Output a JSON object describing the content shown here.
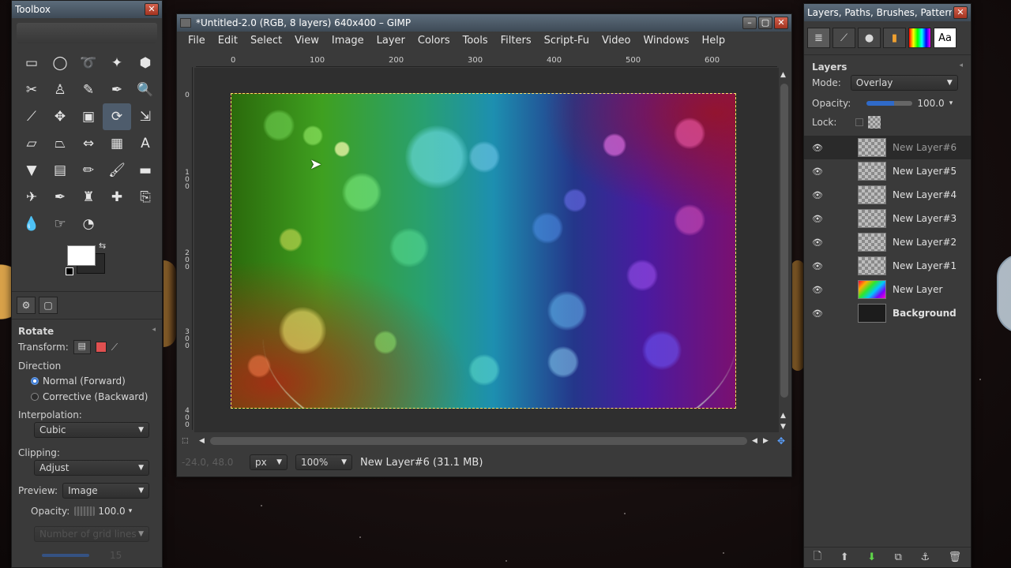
{
  "toolbox": {
    "title": "Toolbox",
    "tools": [
      "rect-select-icon",
      "ellipse-select-icon",
      "lasso-icon",
      "fuzzy-select-icon",
      "select-by-color-icon",
      "scissors-icon",
      "foreground-select-icon",
      "paths-icon",
      "color-picker-icon",
      "zoom-icon",
      "measure-icon",
      "move-icon",
      "crop-icon",
      "rotate-icon",
      "scale-icon",
      "shear-icon",
      "perspective-icon",
      "flip-icon",
      "cage-icon",
      "text-icon",
      "bucket-fill-icon",
      "blend-icon",
      "pencil-icon",
      "paintbrush-icon",
      "eraser-icon",
      "airbrush-icon",
      "ink-icon",
      "clone-icon",
      "heal-icon",
      "perspective-clone-icon",
      "blur-icon",
      "smudge-icon",
      "dodge-burn-icon"
    ],
    "tool_glyphs": [
      "▭",
      "◯",
      "➰",
      "✦",
      "⬢",
      "✂",
      "♙",
      "✎",
      "✒",
      "🔍",
      "⟋",
      "✥",
      "▣",
      "⟳",
      "⇲",
      "▱",
      "⏢",
      "⇔",
      "▦",
      "A",
      "▼",
      "▤",
      "✏",
      "🖌",
      "▬",
      "✈",
      "✒",
      "♜",
      "✚",
      "⎘",
      "💧",
      "☞",
      "◔"
    ],
    "options": {
      "title": "Rotate",
      "transform_label": "Transform:",
      "direction_label": "Direction",
      "dir_normal": "Normal (Forward)",
      "dir_corrective": "Corrective (Backward)",
      "interp_label": "Interpolation:",
      "interp_value": "Cubic",
      "clipping_label": "Clipping:",
      "clipping_value": "Adjust",
      "preview_label": "Preview:",
      "preview_value": "Image",
      "opacity_label": "Opacity:",
      "opacity_value": "100.0",
      "grid_lines_label": "Number of grid lines",
      "grid_lines_value": "15"
    }
  },
  "image_window": {
    "title": "*Untitled-2.0 (RGB, 8 layers) 640x400 – GIMP",
    "menus": [
      "File",
      "Edit",
      "Select",
      "View",
      "Image",
      "Layer",
      "Colors",
      "Tools",
      "Filters",
      "Script-Fu",
      "Video",
      "Windows",
      "Help"
    ],
    "ruler_h": [
      "0",
      "100",
      "200",
      "300",
      "400",
      "500",
      "600"
    ],
    "ruler_v": [
      "0",
      "1 0 0",
      "2 0 0",
      "3 0 0",
      "4 0 0"
    ],
    "status": {
      "coords": "-24.0, 48.0",
      "unit": "px",
      "zoom": "100%",
      "message": "New Layer#6 (31.1 MB)"
    }
  },
  "layers_dock": {
    "title": "Layers, Paths, Brushes, Patterns, ...",
    "panel_title": "Layers",
    "mode_label": "Mode:",
    "mode_value": "Overlay",
    "opacity_label": "Opacity:",
    "opacity_value": "100.0",
    "lock_label": "Lock:",
    "layers": [
      {
        "name": "New Layer#6",
        "thumb": "checker",
        "selected": true
      },
      {
        "name": "New Layer#5",
        "thumb": "checker"
      },
      {
        "name": "New Layer#4",
        "thumb": "checker"
      },
      {
        "name": "New Layer#3",
        "thumb": "checker"
      },
      {
        "name": "New Layer#2",
        "thumb": "checker"
      },
      {
        "name": "New Layer#1",
        "thumb": "checker"
      },
      {
        "name": "New Layer",
        "thumb": "rainbow"
      },
      {
        "name": "Background",
        "thumb": "dark"
      }
    ]
  },
  "colors": {
    "titlebar": "#4a5866",
    "accent": "#3b7ad6",
    "selection": "#ffe26a"
  }
}
